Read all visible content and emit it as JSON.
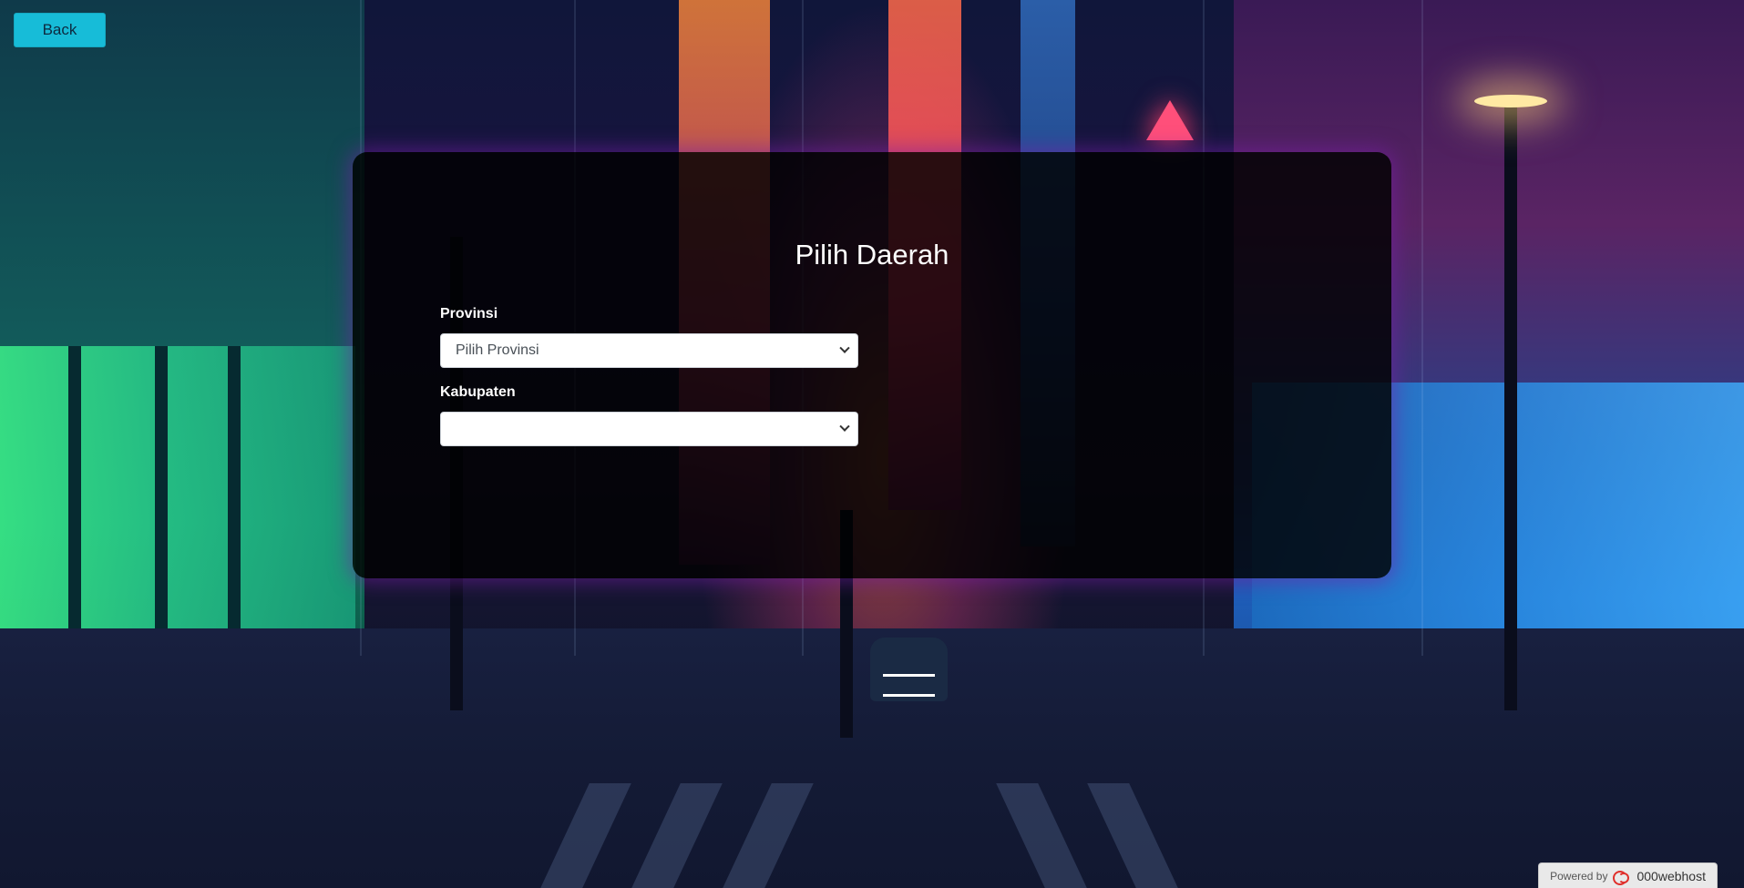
{
  "nav": {
    "back_label": "Back"
  },
  "form": {
    "title": "Pilih Daerah",
    "provinsi": {
      "label": "Provinsi",
      "selected": "Pilih Provinsi"
    },
    "kabupaten": {
      "label": "Kabupaten",
      "selected": ""
    }
  },
  "footer": {
    "powered_label": "Powered by",
    "brand": "000webhost"
  },
  "colors": {
    "back_button": "#17bcd8",
    "panel_bg": "rgba(0,0,0,0.82)",
    "panel_glow": "#7a1ea8",
    "brand_logo": "#e0302c"
  },
  "icons": {
    "select_arrow": "chevron-down-icon",
    "host_logo": "host-logo-icon"
  }
}
